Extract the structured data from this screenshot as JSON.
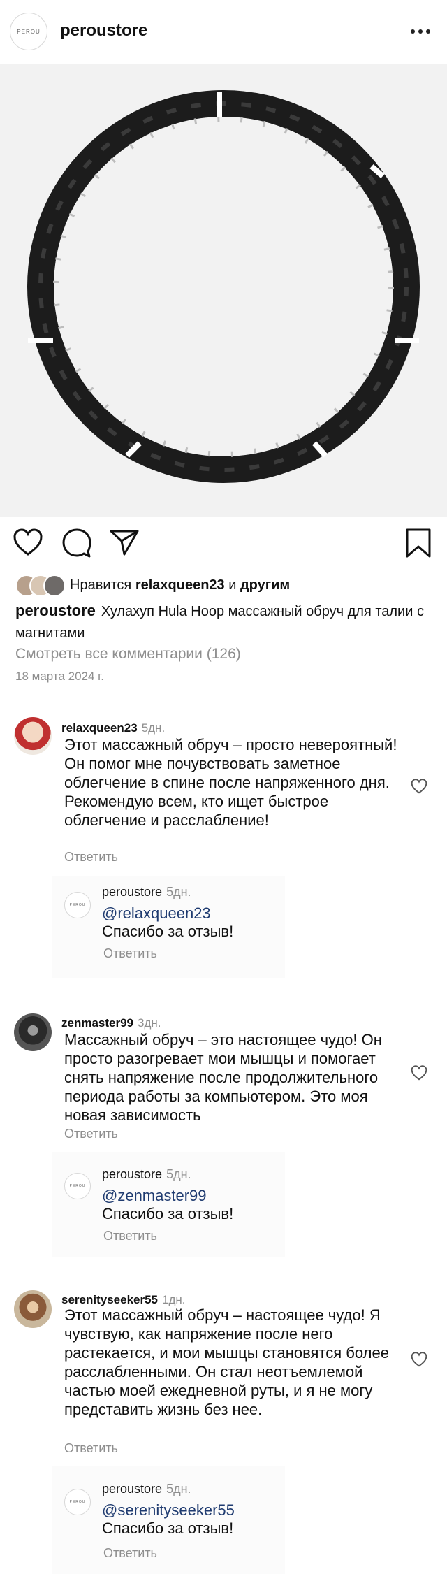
{
  "header": {
    "logo_text": "PEROU",
    "account": "peroustore",
    "more_icon": "more-dots-icon"
  },
  "post": {
    "image_alt": "Hula Hoop massage ring product photo",
    "likes_prefix": "Нравится ",
    "likes_user": "relaxqueen23",
    "likes_mid": " и ",
    "likes_suffix": "другим",
    "caption_user": "peroustore",
    "caption_text": "Хулахуп Hula Hoop массажный обруч для талии с магнитами",
    "view_all": "Смотреть все комментарии (126)",
    "date": "18 марта 2024 г."
  },
  "comments": [
    {
      "user": "relaxqueen23",
      "time": "5дн.",
      "text": "Этот массажный обруч – просто невероятный! Он помог мне почувствовать заметное облегчение в спине после напряженного дня.\nРекомендую всем, кто ищет быстрое облегчение и расслабление!",
      "reply_label": "Ответить",
      "reply": {
        "user": "peroustore",
        "time": "5дн.",
        "mention": "@relaxqueen23",
        "text": "Спасибо за отзыв!",
        "reply_label": "Ответить"
      }
    },
    {
      "user": "zenmaster99",
      "time": "3дн.",
      "text": "Массажный обруч – это настоящее чудо! Он просто разогревает мои мышцы и помогает снять напряжение после продолжительного периода работы за компьютером. Это моя новая зависимость",
      "reply_label": "Ответить",
      "reply": {
        "user": "peroustore",
        "time": "5дн.",
        "mention": "@zenmaster99",
        "text": "Спасибо за отзыв!",
        "reply_label": "Ответить"
      }
    },
    {
      "user": "serenityseeker55",
      "time": "1дн.",
      "text": "Этот массажный обруч – настоящее чудо! Я чувствую, как напряжение после него растекается, и мои мышцы становятся более расслабленными. Он стал неотъемлемой частью моей ежедневной руты, и я не могу представить жизнь без нее.",
      "reply_label": "Ответить",
      "reply": {
        "user": "peroustore",
        "time": "5дн.",
        "mention": "@serenityseeker55",
        "text": "Спасибо за отзыв!",
        "reply_label": "Ответить"
      }
    }
  ]
}
